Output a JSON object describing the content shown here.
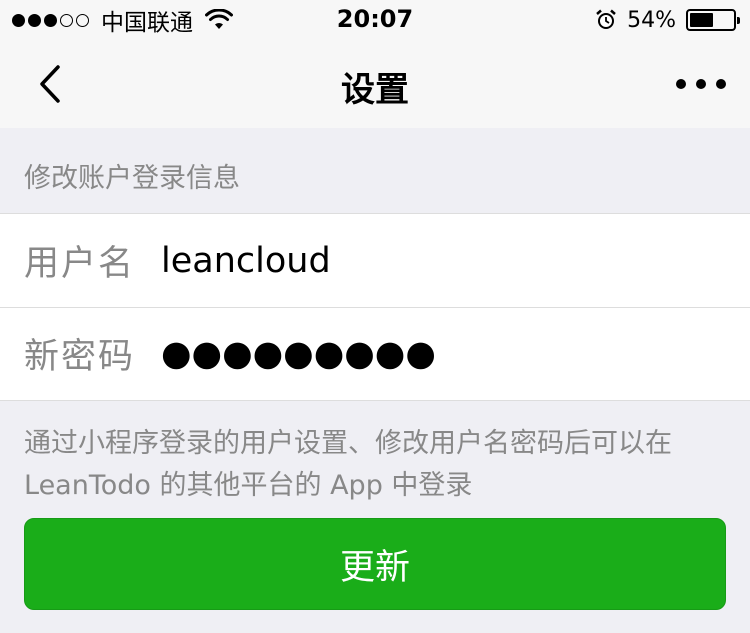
{
  "status_bar": {
    "signal_dots": [
      true,
      true,
      true,
      false,
      false
    ],
    "carrier": "中国联通",
    "time": "20:07",
    "battery_percent": "54%",
    "battery_level": 0.54,
    "icons": [
      "wifi-icon",
      "alarm-icon",
      "battery-icon"
    ]
  },
  "nav": {
    "title": "设置",
    "back_icon": "chevron-left-icon",
    "more_icon": "more-dots-icon"
  },
  "section": {
    "title": "修改账户登录信息"
  },
  "form": {
    "username_label": "用户名",
    "username_value": "leancloud",
    "password_label": "新密码",
    "password_value": "●●●●●●●●●"
  },
  "hint": "通过小程序登录的用户设置、修改用户名密码后可以在 LeanTodo 的其他平台的 App 中登录",
  "update_button": "更新",
  "colors": {
    "primary_green": "#1aad19",
    "background": "#efeff4",
    "secondary_text": "#888888"
  }
}
